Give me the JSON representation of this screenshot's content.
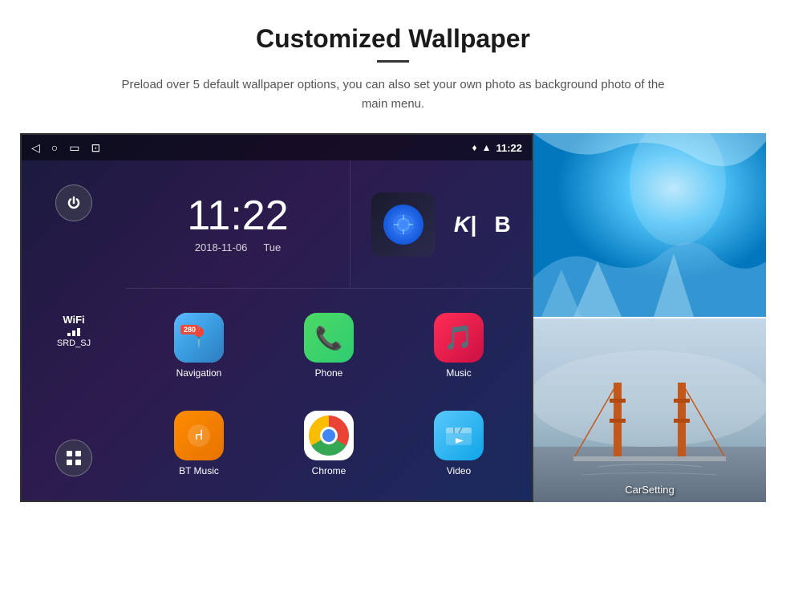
{
  "header": {
    "title": "Customized Wallpaper",
    "description": "Preload over 5 default wallpaper options, you can also set your own photo as background photo of the main menu."
  },
  "status_bar": {
    "time": "11:22"
  },
  "clock": {
    "time": "11:22",
    "date": "2018-11-06",
    "day": "Tue"
  },
  "wifi": {
    "label": "WiFi",
    "network": "SRD_SJ"
  },
  "apps": [
    {
      "name": "Navigation",
      "icon_type": "navigation"
    },
    {
      "name": "Phone",
      "icon_type": "phone"
    },
    {
      "name": "Music",
      "icon_type": "music"
    },
    {
      "name": "BT Music",
      "icon_type": "bt"
    },
    {
      "name": "Chrome",
      "icon_type": "chrome"
    },
    {
      "name": "Video",
      "icon_type": "video"
    }
  ],
  "wallpapers": [
    {
      "name": "ice-cave",
      "label": ""
    },
    {
      "name": "bridge",
      "label": "CarSetting"
    }
  ]
}
